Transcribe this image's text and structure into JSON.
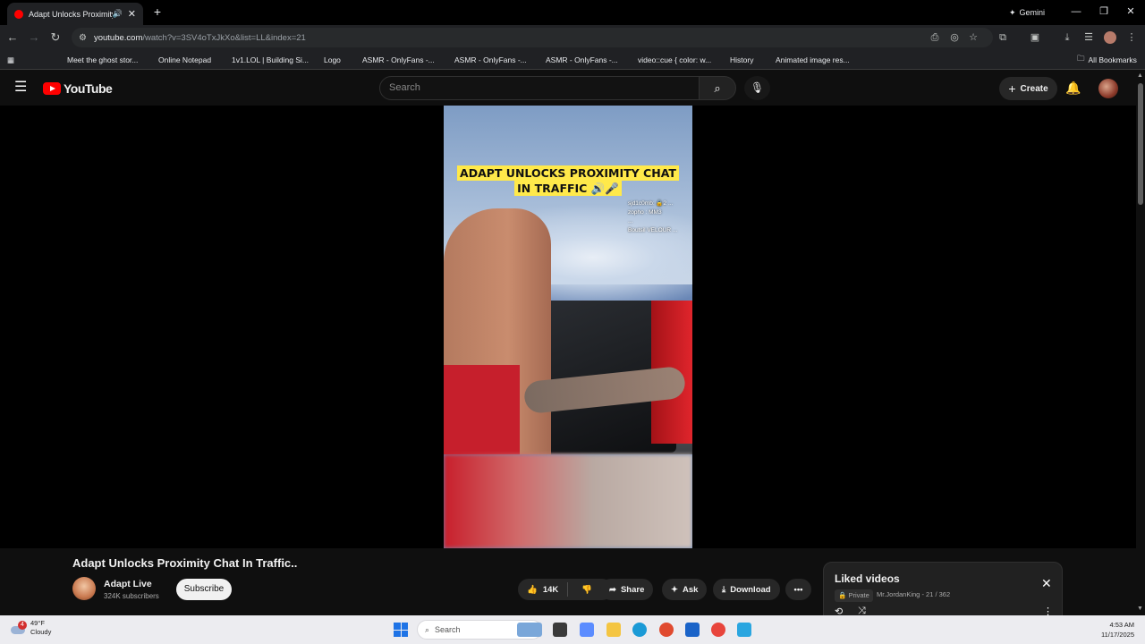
{
  "browser": {
    "tab": {
      "title": "Adapt Unlocks Proximity Chat In Traffic..",
      "audio_icon": "speaker-icon",
      "close": "✕"
    },
    "new_tab": "+",
    "gemini_label": "Gemini",
    "url_host": "youtube.com",
    "url_path": "/watch?v=3SV4oTxJkXo&list=LL&index=21",
    "bookmarks": [
      {
        "label": "",
        "icon": "youtube-icon",
        "color": "#ff0000"
      },
      {
        "label": "Meet the ghost stor...",
        "icon": "youtube-icon",
        "color": "#ff0000"
      },
      {
        "label": "Online Notepad",
        "icon": "notepad-icon",
        "color": "#1a73e8"
      },
      {
        "label": "1v1.LOL | Building Si...",
        "icon": "game-icon",
        "color": "#7b61ff"
      },
      {
        "label": "Logo",
        "icon": "cloud-icon",
        "color": "#cfcfcf"
      },
      {
        "label": "ASMR - OnlyFans -...",
        "icon": "site-icon",
        "color": "#38b2c8"
      },
      {
        "label": "ASMR - OnlyFans -...",
        "icon": "site-icon",
        "color": "#38b2c8"
      },
      {
        "label": "ASMR - OnlyFans -...",
        "icon": "site-icon",
        "color": "#38b2c8"
      },
      {
        "label": "video::cue { color: w...",
        "icon": "globe-icon",
        "color": "#9aa0a6"
      },
      {
        "label": "History",
        "icon": "history-icon",
        "color": "#c4c7c5"
      },
      {
        "label": "Animated image res...",
        "icon": "image-icon",
        "color": "#8ab4f8"
      }
    ],
    "all_bookmarks": "All Bookmarks"
  },
  "youtube": {
    "logo_text": "YouTube",
    "search_placeholder": "Search",
    "create_label": "Create",
    "video": {
      "caption_line1": "ADAPT UNLOCKS PROXIMITY CHAT",
      "caption_line2": "IN TRAFFIC 🔊🎤",
      "chat": [
        "sjd1c0mb: 🔒2 ...",
        "zopho : MM3",
        "...",
        "Boutsil VELOUR ..."
      ]
    },
    "title": "Adapt Unlocks Proximity Chat In Traffic..",
    "channel": {
      "name": "Adapt Live",
      "subscribers": "324K subscribers",
      "subscribe_label": "Subscribe"
    },
    "actions": {
      "likes": "14K",
      "share": "Share",
      "ask": "Ask",
      "download": "Download",
      "more": "•••"
    },
    "playlist": {
      "title": "Liked videos",
      "privacy": "Private",
      "meta": "Mr.JordanKing - 21 / 362"
    }
  },
  "taskbar": {
    "weather_temp": "49°F",
    "weather_desc": "Cloudy",
    "weather_badge": "4",
    "search_placeholder": "Search",
    "time": "4:53 AM",
    "date": "11/17/2025",
    "apps": [
      {
        "name": "widgets-icon",
        "color": "#7aa7d9"
      },
      {
        "name": "task-view-icon",
        "color": "#3a3a3a"
      },
      {
        "name": "copilot-icon",
        "color": "#5b8cff"
      },
      {
        "name": "file-explorer-icon",
        "color": "#f4c542"
      },
      {
        "name": "edge-icon",
        "color": "#1b9ad6"
      },
      {
        "name": "chrome-canary-icon",
        "color": "#e04a2f"
      },
      {
        "name": "store-icon",
        "color": "#1a63c8"
      },
      {
        "name": "chrome-icon",
        "color": "#e8453c"
      },
      {
        "name": "app-icon",
        "color": "#2aa6e0"
      }
    ]
  }
}
